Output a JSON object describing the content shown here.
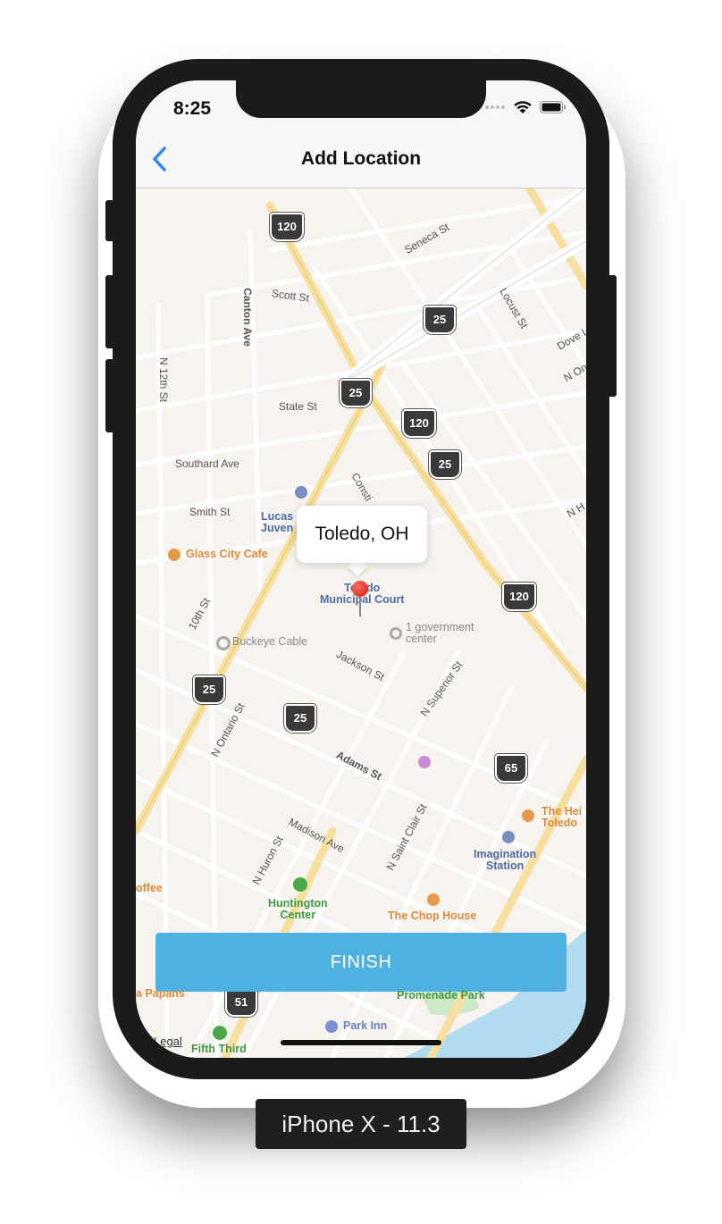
{
  "status": {
    "time": "8:25"
  },
  "nav": {
    "title": "Add Location",
    "back_icon": "chevron-left-icon"
  },
  "map": {
    "street_labels": [
      "Scott St",
      "Seneca St",
      "Canton Ave",
      "Locust St",
      "N 12th St",
      "State St",
      "Dove L",
      "N On",
      "Southard Ave",
      "Consti",
      "Smith St",
      "N H",
      "10th St",
      "Jackson St",
      "N Superior St",
      "N Ontario St",
      "Adams St",
      "Madison Ave",
      "N Saint Clair St",
      "N Huron St"
    ],
    "route_shields": [
      "120",
      "25",
      "25",
      "120",
      "25",
      "120",
      "25",
      "25",
      "65",
      "51"
    ],
    "pois": {
      "lucas_juvenile": "Lucas Cou\nJuven",
      "glass_city_cafe": "Glass City Cafe",
      "toledo_municipal_court": "Toledo\nMunicipal Court",
      "buckeye_cable": "Buckeye Cable",
      "one_government_center": "1 government\ncenter",
      "the_heights_toledo": "The Hei\nToledo",
      "imagination_station": "Imagination\nStation",
      "coffee": "offee",
      "huntington_center": "Huntington\nCenter",
      "the_chop_house": "The Chop House",
      "promenade_park": "Promenade Park",
      "papas": "a Papans",
      "park_inn": "Park Inn",
      "fifth_third": "Fifth Third"
    },
    "callout_title": "Toledo, OH",
    "legal_link": "Legal"
  },
  "finish_label": "FINISH",
  "device_label": "iPhone X - 11.3",
  "colors": {
    "finish_button": "#4fb1e2",
    "back_chevron": "#2f86f6",
    "pin": "#d11b10",
    "water": "#b3dbef"
  }
}
